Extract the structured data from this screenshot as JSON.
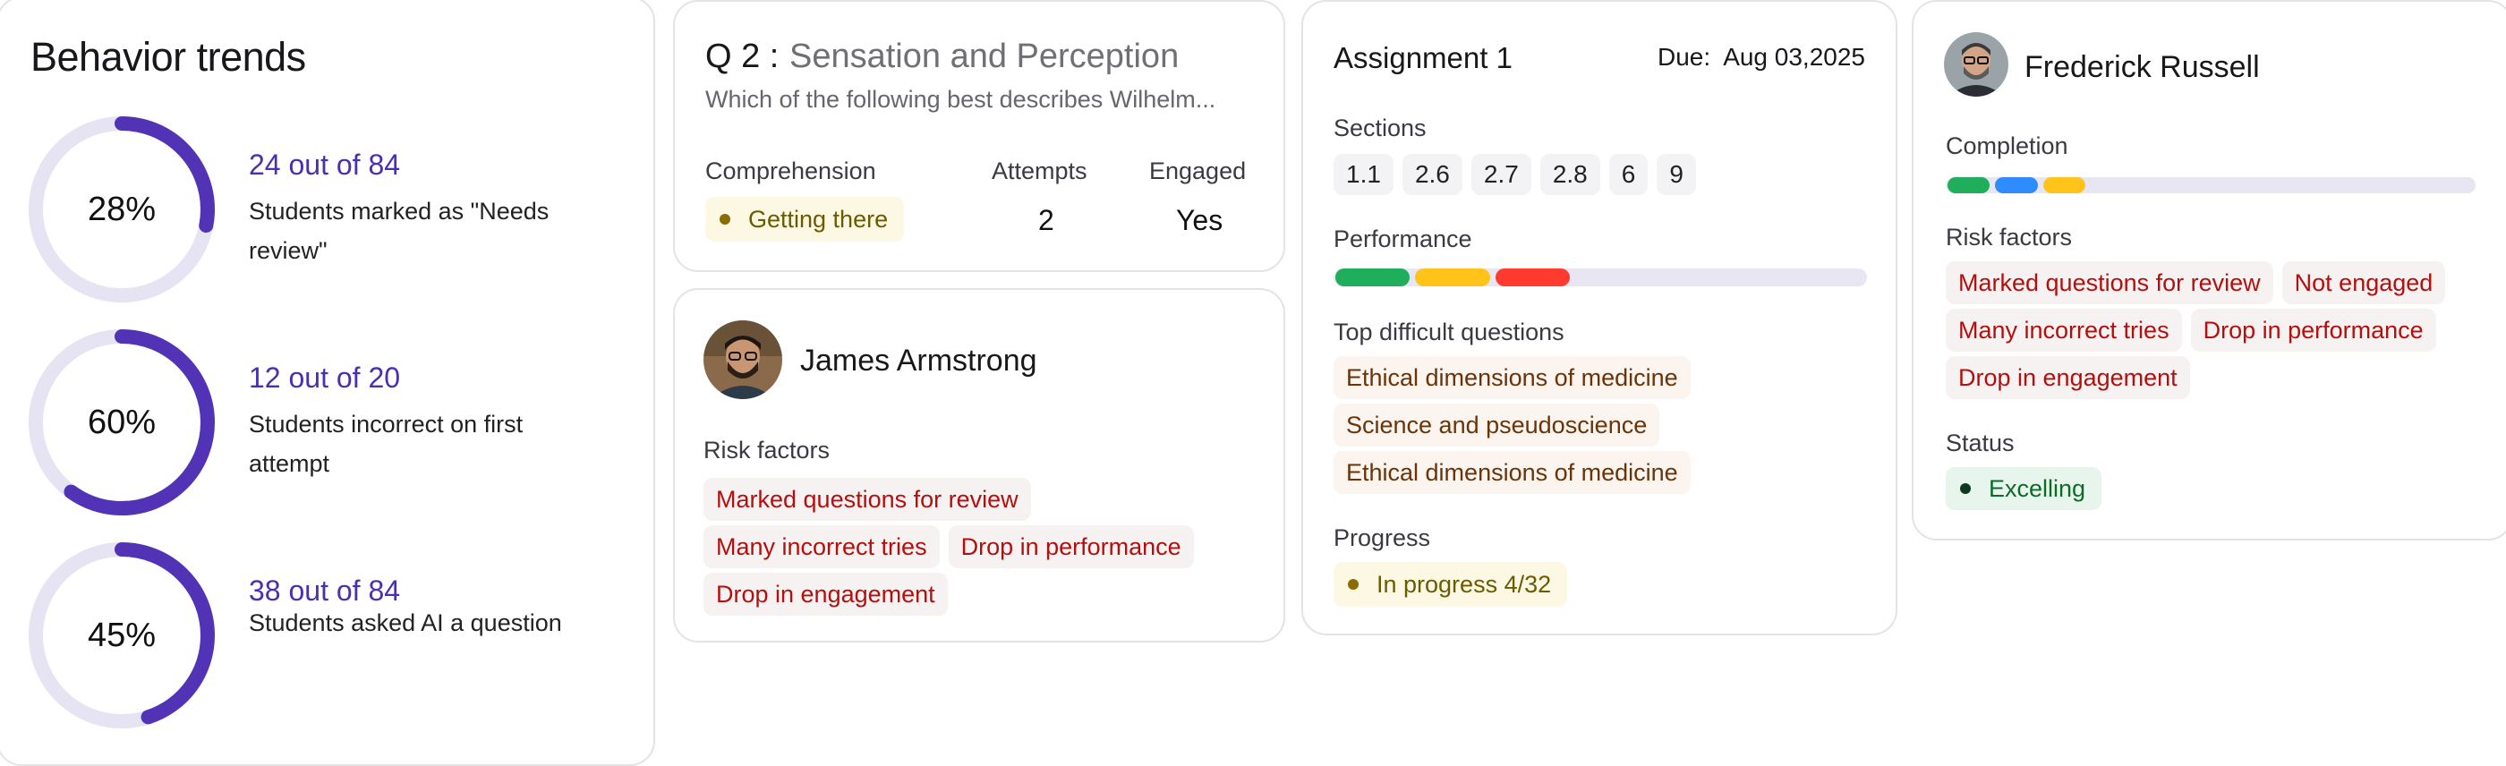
{
  "behavior": {
    "title": "Behavior trends",
    "trends": [
      {
        "percent_label": "28%",
        "fraction": 0.28,
        "count": "24 out of 84",
        "desc": "Students marked as \"Needs review\""
      },
      {
        "percent_label": "60%",
        "fraction": 0.6,
        "count": "12 out of 20",
        "desc": "Students incorrect on first attempt"
      },
      {
        "percent_label": "45%",
        "fraction": 0.45,
        "count": "38 out of 84",
        "desc": "Students asked AI a question"
      }
    ]
  },
  "question": {
    "number": "Q 2 :",
    "title": "Sensation and Perception",
    "text": "Which of the following best describes Wilhelm...",
    "comprehension_label": "Comprehension",
    "comprehension_value": "Getting there",
    "attempts_label": "Attempts",
    "attempts_value": "2",
    "engaged_label": "Engaged",
    "engaged_value": "Yes"
  },
  "james": {
    "name": "James Armstrong",
    "risk_label": "Risk factors",
    "risk_factors": [
      "Marked questions for review",
      "Many incorrect tries",
      "Drop in performance",
      "Drop in engagement"
    ]
  },
  "assignment": {
    "title": "Assignment 1",
    "due_label": "Due:",
    "due_date": "Aug 03,2025",
    "sections_label": "Sections",
    "sections": [
      "1.1",
      "2.6",
      "2.7",
      "2.8",
      "6",
      "9"
    ],
    "performance_label": "Performance",
    "performance": [
      {
        "color": "#1fae5b",
        "fraction": 0.15
      },
      {
        "color": "#ffc31a",
        "fraction": 0.15
      },
      {
        "color": "#ff3b30",
        "fraction": 0.15
      }
    ],
    "difficult_label": "Top difficult questions",
    "difficult": [
      "Ethical dimensions of medicine",
      "Science and pseudoscience",
      "Ethical dimensions of medicine"
    ],
    "progress_label": "Progress",
    "progress_value": "In progress 4/32"
  },
  "frederick": {
    "name": "Frederick Russell",
    "completion_label": "Completion",
    "completion": [
      {
        "color": "#1fae5b",
        "fraction": 0.09
      },
      {
        "color": "#2f8cff",
        "fraction": 0.09
      },
      {
        "color": "#ffc31a",
        "fraction": 0.09
      }
    ],
    "risk_label": "Risk factors",
    "risk_factors": [
      "Marked questions for review",
      "Not engaged",
      "Many incorrect tries",
      "Drop in performance",
      "Drop in engagement"
    ],
    "status_label": "Status",
    "status_value": "Excelling"
  },
  "colors": {
    "accent": "#4a2fb0",
    "ring_track": "#e6e3f3",
    "ring_fill": "#5232b5",
    "risk_bg": "#f7f2f2",
    "risk_text": "#b40f0f",
    "warn_bg": "#fdf8e3",
    "warn_text": "#6b5a00",
    "success_bg": "#e8f5ec",
    "success_text": "#0d6b2a"
  }
}
